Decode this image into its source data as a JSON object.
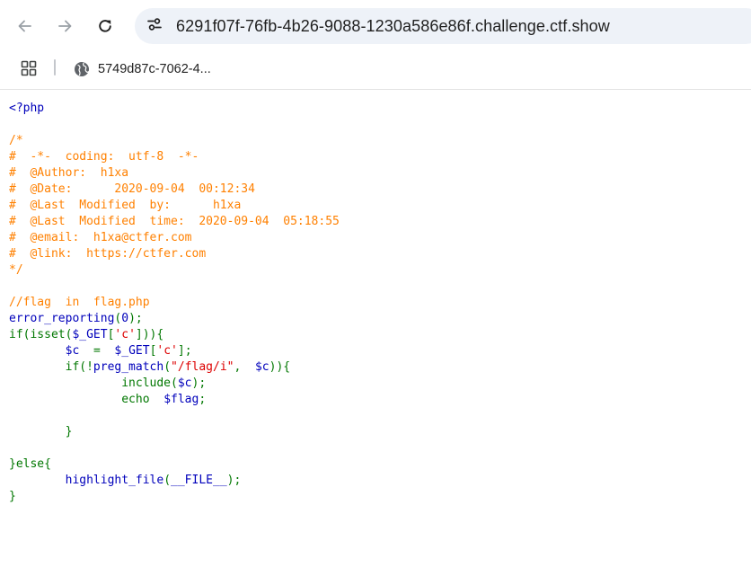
{
  "browser": {
    "url": "6291f07f-76fb-4b26-9088-1230a586e86f.challenge.ctf.show",
    "bookmark_label": "5749d87c-7062-4..."
  },
  "colors": {
    "default": "#0000BB",
    "comment": "#FF8000",
    "keyword": "#007700",
    "string": "#DD0000"
  },
  "code_lines": [
    [
      {
        "t": "<?php",
        "c": "default"
      }
    ],
    [],
    [
      {
        "t": "/*",
        "c": "comment"
      }
    ],
    [
      {
        "t": "#  -*-  coding:  utf-8  -*-",
        "c": "comment"
      }
    ],
    [
      {
        "t": "#  @Author:  h1xa",
        "c": "comment"
      }
    ],
    [
      {
        "t": "#  @Date:      2020-09-04  00:12:34",
        "c": "comment"
      }
    ],
    [
      {
        "t": "#  @Last  Modified  by:      h1xa",
        "c": "comment"
      }
    ],
    [
      {
        "t": "#  @Last  Modified  time:  2020-09-04  05:18:55",
        "c": "comment"
      }
    ],
    [
      {
        "t": "#  @email:  h1xa@ctfer.com",
        "c": "comment"
      }
    ],
    [
      {
        "t": "#  @link:  https://ctfer.com",
        "c": "comment"
      }
    ],
    [
      {
        "t": "*/",
        "c": "comment"
      }
    ],
    [],
    [
      {
        "t": "//flag  in  flag.php",
        "c": "comment"
      }
    ],
    [
      {
        "t": "error_reporting",
        "c": "default"
      },
      {
        "t": "(",
        "c": "keyword"
      },
      {
        "t": "0",
        "c": "default"
      },
      {
        "t": ");",
        "c": "keyword"
      }
    ],
    [
      {
        "t": "if(isset(",
        "c": "keyword"
      },
      {
        "t": "$_GET",
        "c": "default"
      },
      {
        "t": "[",
        "c": "keyword"
      },
      {
        "t": "'c'",
        "c": "string"
      },
      {
        "t": "])){",
        "c": "keyword"
      }
    ],
    [
      {
        "t": "        ",
        "c": "keyword"
      },
      {
        "t": "$c  ",
        "c": "default"
      },
      {
        "t": "=  ",
        "c": "keyword"
      },
      {
        "t": "$_GET",
        "c": "default"
      },
      {
        "t": "[",
        "c": "keyword"
      },
      {
        "t": "'c'",
        "c": "string"
      },
      {
        "t": "];",
        "c": "keyword"
      }
    ],
    [
      {
        "t": "        if(!",
        "c": "keyword"
      },
      {
        "t": "preg_match",
        "c": "default"
      },
      {
        "t": "(",
        "c": "keyword"
      },
      {
        "t": "\"/flag/i\"",
        "c": "string"
      },
      {
        "t": ",  ",
        "c": "keyword"
      },
      {
        "t": "$c",
        "c": "default"
      },
      {
        "t": ")){",
        "c": "keyword"
      }
    ],
    [
      {
        "t": "                include(",
        "c": "keyword"
      },
      {
        "t": "$c",
        "c": "default"
      },
      {
        "t": ");",
        "c": "keyword"
      }
    ],
    [
      {
        "t": "                echo  ",
        "c": "keyword"
      },
      {
        "t": "$flag",
        "c": "default"
      },
      {
        "t": ";",
        "c": "keyword"
      }
    ],
    [],
    [
      {
        "t": "        }",
        "c": "keyword"
      }
    ],
    [],
    [
      {
        "t": "}else{",
        "c": "keyword"
      }
    ],
    [
      {
        "t": "        ",
        "c": "keyword"
      },
      {
        "t": "highlight_file",
        "c": "default"
      },
      {
        "t": "(",
        "c": "keyword"
      },
      {
        "t": "__FILE__",
        "c": "default"
      },
      {
        "t": ");",
        "c": "keyword"
      }
    ],
    [
      {
        "t": "}",
        "c": "keyword"
      }
    ]
  ]
}
